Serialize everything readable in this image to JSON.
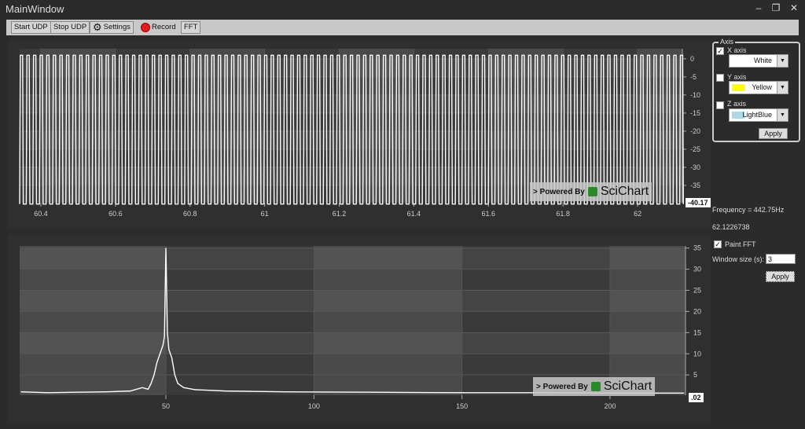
{
  "window": {
    "title": "MainWindow",
    "minimize": "–",
    "restore": "❐",
    "close": "✕"
  },
  "toolbar": {
    "start": "Start UDP",
    "stop": "Stop UDP",
    "settings": "Settings",
    "record": "Record",
    "fft": "FFT"
  },
  "axis_group": {
    "legend": "Axis",
    "x": {
      "label": "X axis",
      "checked": true,
      "color": "White",
      "swatch": "#ffffff"
    },
    "y": {
      "label": "Y axis",
      "checked": false,
      "color": "Yellow",
      "swatch": "#ffff00"
    },
    "z": {
      "label": "Z axis",
      "checked": false,
      "color": "LightBlue",
      "swatch": "#add8e6"
    },
    "apply": "Apply"
  },
  "info": {
    "frequency": "Frequency = 442.75Hz",
    "time": "62.1226738"
  },
  "fft_settings": {
    "paint_label": "Paint FFT",
    "paint_checked": true,
    "window_label": "Window size (s):",
    "window_value": "3",
    "apply": "Apply"
  },
  "watermark": {
    "powered": "> Powered By",
    "brand": "SciChart"
  },
  "chart_data": [
    {
      "type": "line",
      "title": "Time signal",
      "xlim": [
        60.343,
        62.12
      ],
      "ylim": [
        -39.8,
        2.8
      ],
      "xticks": [
        "60.4",
        "60.6",
        "60.8",
        "61",
        "61.2",
        "61.4",
        "61.6",
        "61.8",
        "62"
      ],
      "yticks": [
        "0",
        "-5",
        "-10",
        "-15",
        "-20",
        "-25",
        "-30",
        "-35"
      ],
      "series": [
        {
          "name": "X axis",
          "color": "#ffffff",
          "cycles_per_unit": 56.5,
          "high": 1,
          "low": -40.17
        }
      ],
      "cursor_label": "-40.17"
    },
    {
      "type": "line",
      "title": "FFT",
      "xlim": [
        0.6,
        225.5
      ],
      "ylim": [
        0.2,
        35.5
      ],
      "xticks": [
        "50",
        "100",
        "150",
        "200"
      ],
      "yticks": [
        "35",
        "30",
        "25",
        "20",
        "15",
        "10",
        "5"
      ],
      "series": [
        {
          "name": "FFT",
          "color": "#ffffff",
          "x": [
            1,
            10,
            20,
            30,
            38,
            42,
            44,
            45,
            46,
            47,
            48,
            49,
            49.5,
            50,
            50.5,
            51,
            52,
            53,
            54,
            56,
            60,
            70,
            90,
            120,
            150,
            180,
            200,
            225
          ],
          "y": [
            1,
            0.8,
            0.9,
            1,
            1.2,
            2,
            1.6,
            3,
            5,
            8,
            10,
            12,
            14,
            35,
            15,
            11,
            9,
            5,
            3,
            2,
            1.5,
            1.2,
            1,
            0.9,
            0.8,
            0.8,
            0.7,
            0.7
          ]
        }
      ],
      "cursor_label": ".02"
    }
  ]
}
